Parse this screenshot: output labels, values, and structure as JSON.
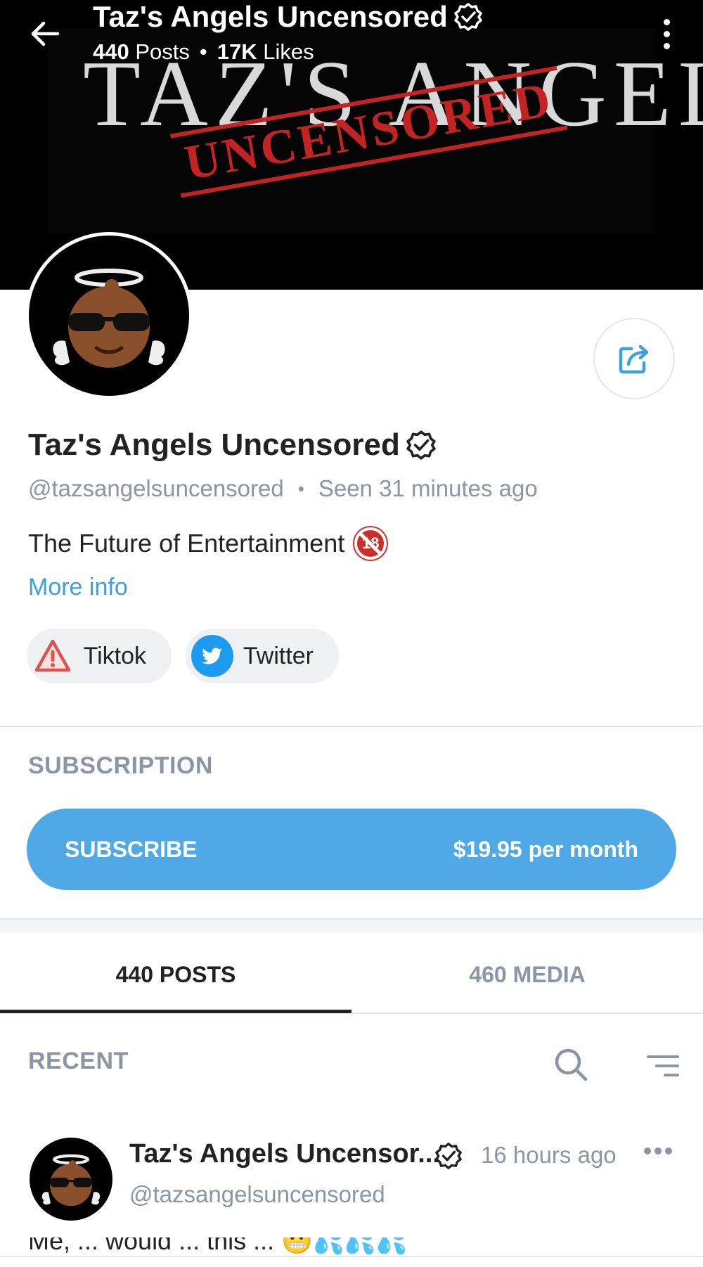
{
  "header": {
    "title": "Taz's Angels Uncensored",
    "posts_count": "440",
    "posts_label": "Posts",
    "likes_count": "17K",
    "likes_label": "Likes",
    "separator": "•"
  },
  "cover": {
    "wordmark": "TAZ'S ANGELS",
    "stamp": "UNCENSORED"
  },
  "profile": {
    "name": "Taz's Angels Uncensored",
    "handle": "@tazsangelsuncensored",
    "separator": "•",
    "last_seen": "Seen 31 minutes ago",
    "bio": "The Future of Entertainment",
    "bio_badge": "18",
    "more_info": "More info",
    "links": [
      {
        "label": "Tiktok",
        "icon": "warning-icon"
      },
      {
        "label": "Twitter",
        "icon": "twitter-icon"
      }
    ]
  },
  "subscription": {
    "section_label": "SUBSCRIPTION",
    "button_label": "SUBSCRIBE",
    "price": "$19.95 per month"
  },
  "tabs": [
    {
      "label": "440 POSTS",
      "active": true
    },
    {
      "label": "460 MEDIA",
      "active": false
    }
  ],
  "feed": {
    "section_label": "RECENT",
    "post": {
      "author": "Taz's Angels Uncensor...",
      "time": "16 hours ago",
      "handle": "@tazsangelsuncensored",
      "text_partial": "Me, ... would ... this ... 😬💦💦💦"
    }
  },
  "colors": {
    "accent": "#4fa9e6",
    "muted": "#8a96a3",
    "link": "#3e9fe0",
    "stamp_red": "#c32323"
  }
}
